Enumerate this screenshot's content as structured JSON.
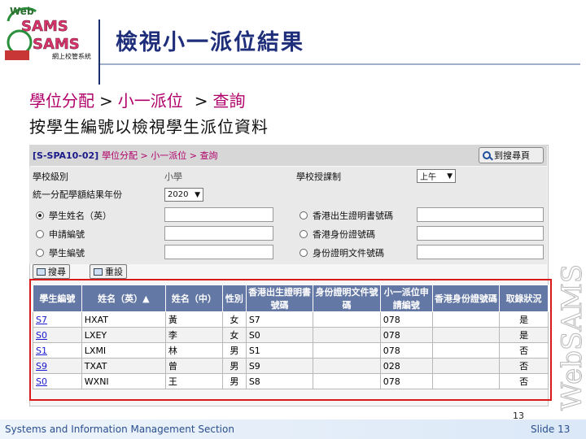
{
  "header": {
    "title": "檢視小一派位結果",
    "logo_text": "Web SAMS 網上校管系統"
  },
  "breadcrumb": {
    "part1": "學位分配",
    "sep1": ">",
    "part2": "小一派位",
    "sep2": ">",
    "part3": "查詢"
  },
  "subtitle": "按學生編號以檢視學生派位資料",
  "screen": {
    "page_id": "[S-SPA10-02]",
    "path": "學位分配 > 小一派位 > 查詢",
    "back_button": "到搜尋頁",
    "form": {
      "school_level_label": "學校級別",
      "school_level_value": "小學",
      "session_label": "學校授課制",
      "session_value": "上午",
      "year_label": "統一分配學額結果年份",
      "year_value": "2020",
      "radios_left": [
        {
          "label": "學生姓名（英）",
          "checked": true
        },
        {
          "label": "申請編號",
          "checked": false
        },
        {
          "label": "學生編號",
          "checked": false
        }
      ],
      "radios_right": [
        {
          "label": "香港出生證明書號碼",
          "checked": false
        },
        {
          "label": "香港身份證號碼",
          "checked": false
        },
        {
          "label": "身份證明文件號碼",
          "checked": false
        }
      ],
      "search_button": "搜尋",
      "reset_button": "重設"
    },
    "table": {
      "headers": [
        "學生編號",
        "姓名（英）▲",
        "姓名（中）",
        "性別",
        "香港出生證明書號碼",
        "身份證明文件號碼",
        "小一派位申請編號",
        "香港身份證號碼",
        "取錄狀況"
      ],
      "rows": [
        [
          "S7",
          "HXAT",
          "黃",
          "女",
          "S7",
          "",
          "078",
          "",
          "是"
        ],
        [
          "S0",
          "LXEY",
          "李",
          "女",
          "S0",
          "",
          "078",
          "",
          "是"
        ],
        [
          "S1",
          "LXMI",
          "林",
          "男",
          "S1",
          "",
          "078",
          "",
          "否"
        ],
        [
          "S9",
          "TXAT",
          "曾",
          "男",
          "S9",
          "",
          "028",
          "",
          "否"
        ],
        [
          "S0",
          "WXNI",
          "王",
          "男",
          "S8",
          "",
          "078",
          "",
          "否"
        ]
      ]
    }
  },
  "watermark": "WebSAMS",
  "slide_number": "13",
  "footer": {
    "left": "Systems and Information Management Section",
    "right": "Slide 13"
  },
  "colors": {
    "title": "#1f2e7a",
    "crumb": "#b0006a",
    "table_header": "#6478a6",
    "highlight_box": "#d81a1a"
  }
}
